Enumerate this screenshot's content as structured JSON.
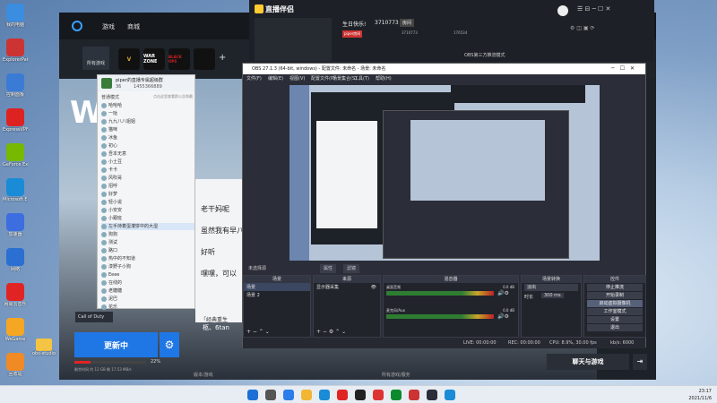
{
  "desktop_icons": [
    {
      "label": "我的电脑",
      "color": "#3b8de0"
    },
    {
      "label": "ExplorerPatcher",
      "color": "#c33"
    },
    {
      "label": "控制面板",
      "color": "#3a7bd5"
    },
    {
      "label": "ExpressVPN",
      "color": "#d22"
    },
    {
      "label": "GeForce Experience",
      "color": "#76b900"
    },
    {
      "label": "Microsoft Edge",
      "color": "#1a8bd6"
    },
    {
      "label": "加速器",
      "color": "#3c6ee0"
    },
    {
      "label": "网络",
      "color": "#2a6fd1"
    },
    {
      "label": "网易云音乐",
      "color": "#e02424"
    },
    {
      "label": "WeGame",
      "color": "#f5a623"
    },
    {
      "label": "回收站",
      "color": "#f08a24"
    }
  ],
  "desktop_folder": {
    "label": "obs-studio"
  },
  "launcher": {
    "tabs": [
      "游戏",
      "商城"
    ],
    "home_tile": "所有游戏",
    "games": [
      "V",
      "WAR ZONE",
      "BLACK OPS"
    ],
    "hero_title": "WA",
    "update_button": "更新中",
    "progress_percent": 22,
    "progress_text": "22%",
    "size_text": "剩余时间 约 12 GB 剩 17.53 MB/s",
    "game_selector": "Call of Duty",
    "bottom_label": "版本/游戏",
    "bottom_label2": "所有游戏/服务"
  },
  "live": {
    "logo": "直播伴侣",
    "birthday": "生日快乐!",
    "room_id": "3710773",
    "room_tag": "房间",
    "info1": "piper房间",
    "info2": "3710773",
    "info3": "176534",
    "mode": "OBS第三方推流模式",
    "start_button": "聊天与游戏"
  },
  "chat": {
    "header": "piper的直播专属超级群",
    "group_id": "1455366889",
    "member_count": "36",
    "mode_label": "普通模式",
    "announce": "点击这里查看群公告和最新消息",
    "members": [
      "哈哈哈",
      "一哒",
      "九九八八姐姐",
      "猫咪",
      "冰鱼",
      "初心",
      "吾本无意",
      "小土豆",
      "卡卡",
      "风吹哥",
      "招呼",
      "好梦",
      "轻小说",
      "小安安",
      "小跟班",
      "左手持着蛋灌饼中的大湿",
      "狗狗",
      "测试",
      "路口",
      "热中的不知道",
      "漆野子小狗",
      "Eeee",
      "在线的",
      "老糖糖",
      "泥巴",
      "花乐"
    ],
    "messages": [
      {
        "name": "老千妈妮",
        "text": "老干妈呢"
      },
      {
        "name": "南风",
        "text": "虽然我有早八"
      },
      {
        "name": "匿名",
        "text": "好听"
      },
      {
        "name": "匿名2",
        "text": "嘿嘿，可以"
      }
    ],
    "bottom_text": "「经典重生",
    "bottom_text2": "柩、6tan"
  },
  "obs": {
    "title": "OBS 27.1.3 (64-bit, windows) - 配置文件: 未命名 - 场景: 未命名",
    "menu": [
      "文件(F)",
      "编辑(E)",
      "视图(V)",
      "配置文件(P)",
      "场景集合(S)",
      "工具(T)",
      "帮助(H)"
    ],
    "no_source": "未选择源",
    "properties_btn": "属性",
    "filters_btn": "滤镜",
    "docks": {
      "scenes": {
        "title": "场景",
        "items": [
          "场景",
          "场景 2"
        ]
      },
      "sources": {
        "title": "来源",
        "items": [
          "显示器采集"
        ]
      },
      "mixer": {
        "title": "混音器",
        "items": [
          "桌面音频",
          "麦克风/Aux"
        ],
        "levels": [
          "0.0 dB",
          "0.0 dB"
        ]
      },
      "transitions": {
        "title": "场景转换",
        "type": "淡出",
        "duration_label": "时长",
        "duration": "300 ms"
      },
      "controls": {
        "title": "控件",
        "buttons": [
          "停止推流",
          "开始录制",
          "启动虚拟摄像机",
          "工作室模式",
          "设置",
          "退出"
        ]
      }
    },
    "status": {
      "live": "LIVE: 00:00:00",
      "rec": "REC: 00:00:00",
      "cpu": "CPU: 8.9%, 30.00 fps",
      "kbps": "kb/s: 6000"
    }
  },
  "taskbar": {
    "time": "23:17",
    "date": "2021/11/6"
  }
}
